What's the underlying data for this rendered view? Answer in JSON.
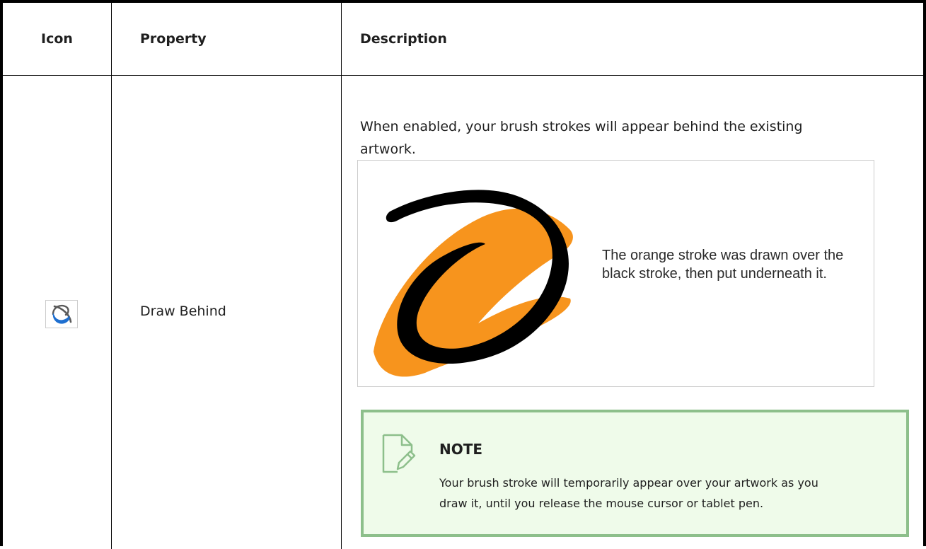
{
  "table": {
    "headers": {
      "icon": "Icon",
      "property": "Property",
      "description": "Description"
    },
    "rows": [
      {
        "icon_name": "draw-behind-icon",
        "property": "Draw Behind",
        "description": "When enabled, your brush strokes will appear behind the existing artwork.",
        "illustration": {
          "caption": "The orange stroke was drawn over the black stroke, then put underneath it.",
          "colors": {
            "orange_stroke": "#f7941d",
            "black_stroke": "#000000"
          }
        },
        "note": {
          "title": "NOTE",
          "text": "Your brush stroke will temporarily appear over your artwork as you draw it, until you release the mouse cursor or tablet pen.",
          "icon_name": "note-pencil-icon"
        }
      }
    ]
  },
  "colors": {
    "note_border": "#8dbf8b",
    "note_background": "#effbea",
    "icon_blue": "#1e6fd0"
  }
}
